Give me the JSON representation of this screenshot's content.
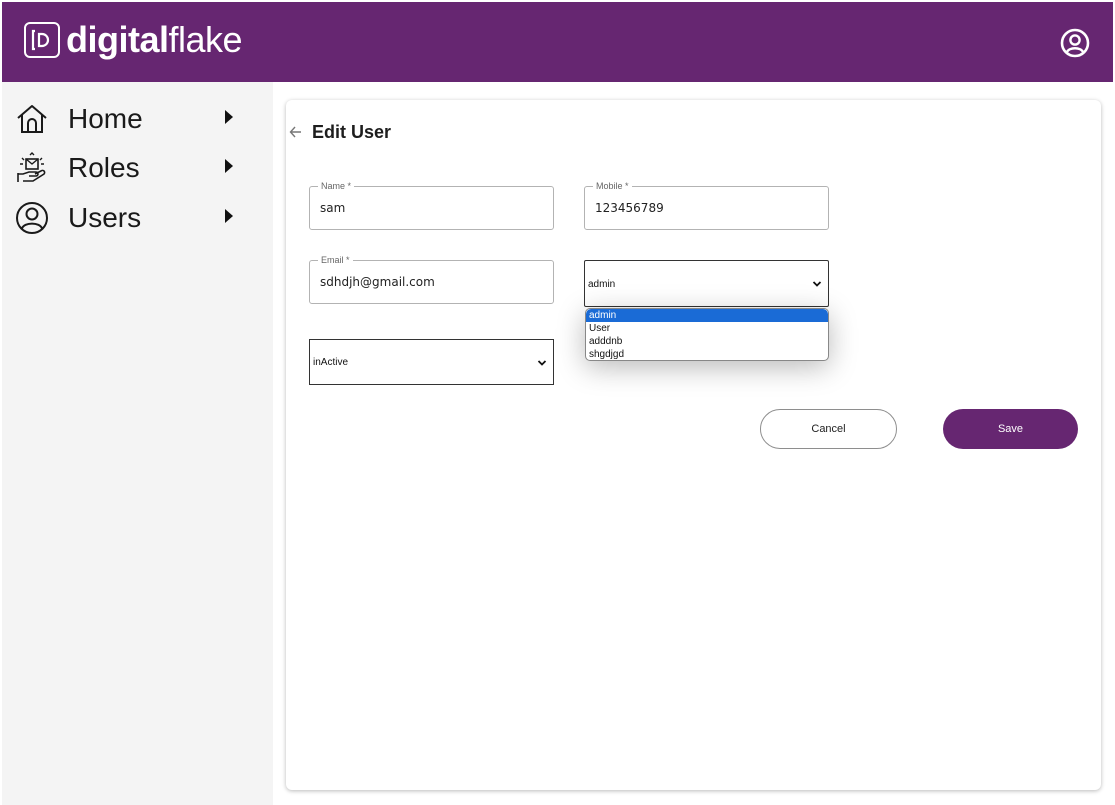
{
  "header": {
    "brand_bold": "digital",
    "brand_light": "flake",
    "logo_icon": "bracket-d-logo",
    "profile_icon": "user-circle-icon",
    "background": "#662671"
  },
  "sidebar": {
    "items": [
      {
        "label": "Home",
        "icon": "home-icon"
      },
      {
        "label": "Roles",
        "icon": "roles-icon"
      },
      {
        "label": "Users",
        "icon": "user-circle-icon"
      }
    ]
  },
  "page": {
    "title": "Edit User",
    "back_icon": "arrow-left-icon"
  },
  "form": {
    "name": {
      "label": "Name *",
      "value": "sam"
    },
    "mobile": {
      "label": "Mobile *",
      "value": "123456789"
    },
    "email": {
      "label": "Email *",
      "value": "sdhdjh@gmail.com"
    },
    "role_select": {
      "value": "admin",
      "options": [
        "admin",
        "User",
        "adddnb",
        "shgdjgd"
      ],
      "highlighted": "admin"
    },
    "status_select": {
      "value": "inActive"
    }
  },
  "actions": {
    "cancel_label": "Cancel",
    "save_label": "Save"
  },
  "colors": {
    "brand": "#662671",
    "option_highlight": "#1a6bd6"
  }
}
